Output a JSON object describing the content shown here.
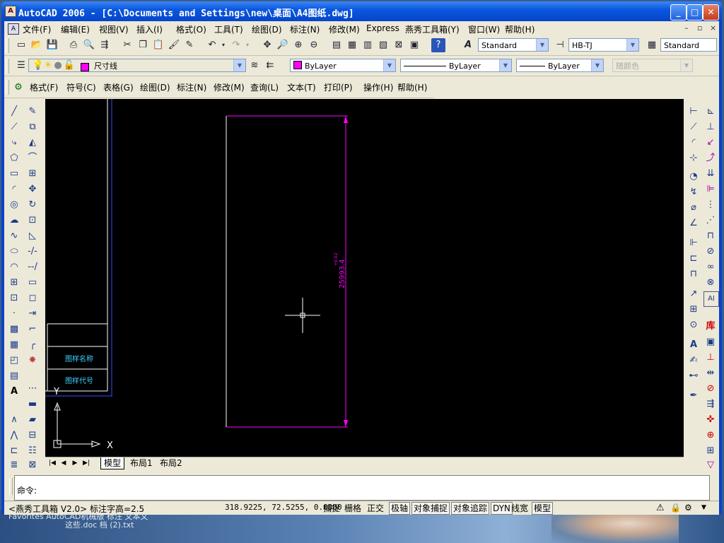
{
  "window": {
    "title": "AutoCAD 2006 - [C:\\Documents and Settings\\new\\桌面\\A4图纸.dwg]",
    "app_icon": "autocad-icon"
  },
  "menubar": {
    "items": [
      "文件(F)",
      "编辑(E)",
      "视图(V)",
      "插入(I)",
      "格式(O)",
      "工具(T)",
      "绘图(D)",
      "标注(N)",
      "修改(M)",
      "Express",
      "燕秀工具箱(Y)",
      "窗口(W)",
      "帮助(H)"
    ],
    "doc_controls": [
      "–",
      "▫",
      "×"
    ]
  },
  "toolbar_standard": {
    "text_style": "Standard",
    "dim_style": "HB-TJ",
    "table_style": "Standard"
  },
  "toolbar_layers": {
    "current_layer": "尺寸线",
    "layer_color": "#ff00ff",
    "color_value": "ByLayer",
    "linetype_value": "ByLayer",
    "lineweight_value": "ByLayer",
    "plotstyle_value": "随颜色"
  },
  "toolbar_custom": {
    "items": [
      "格式(F)",
      "符号(C)",
      "表格(G)",
      "绘图(D)",
      "标注(N)",
      "修改(M)",
      "查询(L)",
      "文本(T)",
      "打印(P)",
      "操作(H)",
      "帮助(H)"
    ]
  },
  "drawing": {
    "dimension_text": "25993.4",
    "dimension_superscript": "+0.02",
    "dimension_color": "#ff00ff",
    "rect_color": "#ff00ff",
    "title_block_text_1": "图样名称",
    "title_block_text_2": "图样代号",
    "ucs_x": "X",
    "ucs_y": "Y"
  },
  "layout_tabs": [
    "模型",
    "布局1",
    "布局2"
  ],
  "command": {
    "prompt": "命令:"
  },
  "statusbar": {
    "toolbox_info": "<燕秀工具箱 V2.0> 标注字高=2.5",
    "coordinates": "318.9225, 72.5255, 0.0000",
    "toggles": [
      {
        "label": "捕捉",
        "on": false
      },
      {
        "label": "栅格",
        "on": false
      },
      {
        "label": "正交",
        "on": false
      },
      {
        "label": "极轴",
        "on": true
      },
      {
        "label": "对象捕捉",
        "on": true
      },
      {
        "label": "对象追踪",
        "on": true
      },
      {
        "label": "DYN",
        "on": true
      },
      {
        "label": "线宽",
        "on": false
      },
      {
        "label": "模型",
        "on": true
      }
    ]
  },
  "desktop": {
    "line1": "Favorites    AutoCAD机械版    标注 文本文",
    "line2": "这些.doc    档 (2).txt"
  }
}
